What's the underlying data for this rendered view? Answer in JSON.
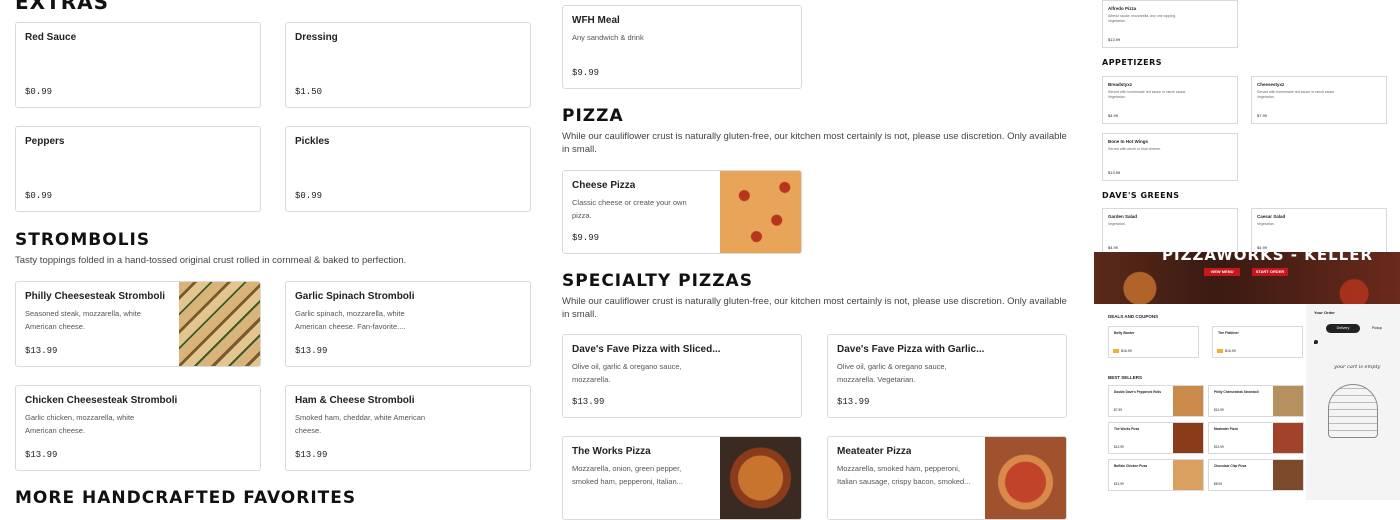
{
  "extras": {
    "title": "EXTRAS",
    "items": [
      {
        "name": "Red Sauce",
        "price": "$0.99"
      },
      {
        "name": "Dressing",
        "price": "$1.50"
      },
      {
        "name": "Peppers",
        "price": "$0.99"
      },
      {
        "name": "Pickles",
        "price": "$0.99"
      }
    ]
  },
  "strombolis": {
    "title": "STROMBOLIS",
    "description": "Tasty toppings folded in a hand-tossed original crust rolled in cornmeal & baked to perfection.",
    "items": [
      {
        "name": "Philly Cheesesteak Stromboli",
        "desc": "Seasoned steak, mozzarella, white American cheese.",
        "price": "$13.99"
      },
      {
        "name": "Garlic Spinach Stromboli",
        "desc": "Garlic spinach, mozzarella, white American cheese. Fan-favorite....",
        "price": "$13.99"
      },
      {
        "name": "Chicken Cheesesteak Stromboli",
        "desc": "Garlic chicken, mozzarella, white American cheese.",
        "price": "$13.99"
      },
      {
        "name": "Ham & Cheese Stromboli",
        "desc": "Smoked ham, cheddar, white American cheese.",
        "price": "$13.99"
      }
    ]
  },
  "more": {
    "title": "MORE HANDCRAFTED FAVORITES"
  },
  "wfh": {
    "name": "WFH Meal",
    "desc": "Any sandwich & drink",
    "price": "$9.99"
  },
  "pizza": {
    "title": "PIZZA",
    "description": "While our cauliflower crust is naturally gluten-free, our kitchen most certainly is not, please use discretion. Only available in small.",
    "items": [
      {
        "name": "Cheese Pizza",
        "desc": "Classic cheese or create your own pizza.",
        "price": "$9.99"
      }
    ]
  },
  "specialty": {
    "title": "SPECIALTY PIZZAS",
    "description": "While our cauliflower crust is naturally gluten-free, our kitchen most certainly is not, please use discretion. Only available in small.",
    "items": [
      {
        "name": "Dave's Fave Pizza with Sliced...",
        "desc": "Olive oil, garlic & oregano sauce, mozzarella.",
        "price": "$13.99"
      },
      {
        "name": "Dave's Fave Pizza with Garlic...",
        "desc": "Olive oil, garlic & oregano sauce, mozzarella. Vegetarian.",
        "price": "$13.99"
      },
      {
        "name": "The Works Pizza",
        "desc": "Mozzarella, onion, green pepper, smoked ham, pepperoni, Italian...",
        "price": ""
      },
      {
        "name": "Meateater Pizza",
        "desc": "Mozzarella, smoked ham, pepperoni, Italian sausage, crispy bacon, smoked...",
        "price": ""
      }
    ]
  },
  "preview_top": {
    "alfredo": {
      "name": "Alfredo Pizza",
      "desc": "Alfredo sauce, mozzarella, any one topping. Vegetarian.",
      "price": "$13.99"
    },
    "appetizers_title": "APPETIZERS",
    "appetizers": [
      {
        "name": "Breadstyxz",
        "desc": "Served with homemade red sauce or ranch sauce. Vegetarian.",
        "price": "$4.99"
      },
      {
        "name": "Cheesestyxz",
        "desc": "Served with homemade red sauce or ranch sauce. Vegetarian.",
        "price": "$7.99"
      },
      {
        "name": "Bone In Hot Wings",
        "desc": "Served with ranch or blue cheese.",
        "price": "$13.99"
      }
    ],
    "greens_title": "DAVE'S GREENS",
    "greens": [
      {
        "name": "Garden Salad",
        "desc": "Vegetarian.",
        "price": "$4.99"
      },
      {
        "name": "Caesar Salad",
        "desc": "Vegetarian.",
        "price": "$4.99"
      }
    ]
  },
  "preview_bottom": {
    "brand": "PIZZAWORKS - KELLER",
    "btn_menu": "VIEW MENU",
    "btn_order": "START ORDER",
    "deals_title": "DEALS AND COUPONS",
    "best_title": "BEST SELLERS",
    "your_order": "Your Order",
    "delivery": "Delivery",
    "pickup": "Pickup",
    "empty_cart": "your cart is empty",
    "deals": [
      {
        "name": "Belly Buster",
        "price": "$16.99"
      },
      {
        "name": "The Flatliner",
        "price": "$16.99"
      }
    ],
    "best": [
      {
        "name": "Double Dave's Pepperoni Rolls",
        "price": "$7.99"
      },
      {
        "name": "Philly Cheesesteak Stromboli",
        "price": "$13.99"
      },
      {
        "name": "The Works Pizza",
        "price": "$13.99"
      },
      {
        "name": "Meateater Pizza",
        "price": "$13.99"
      },
      {
        "name": "Buffalo Chicken Pizza",
        "price": "$13.99"
      },
      {
        "name": "Chocolate Chip Pizza",
        "price": "$8.99"
      }
    ]
  },
  "colors": {
    "accent": "#c8161d",
    "border": "#d9d9d9",
    "text": "#222222"
  }
}
